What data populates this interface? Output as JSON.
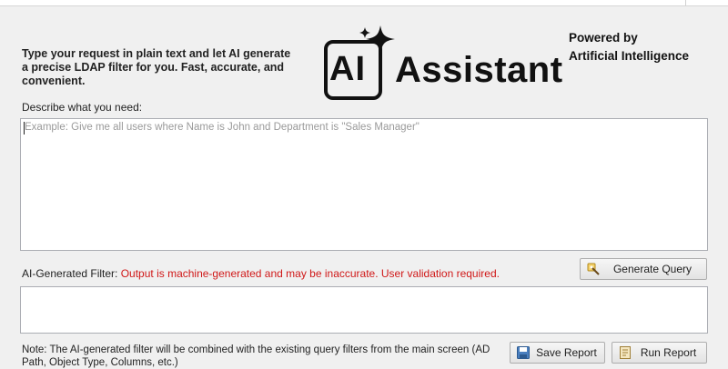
{
  "intro_text": "Type your request in plain text and let AI generate a precise LDAP filter for you. Fast, accurate, and convenient.",
  "logo": {
    "ai": "AI",
    "word": "Assistant"
  },
  "powered_by": {
    "line1": "Powered by",
    "line2": "Artificial Intelligence"
  },
  "request": {
    "label": "Describe what you need:",
    "value": "",
    "placeholder": "Example: Give me all users where Name is John and Department is \"Sales Manager\""
  },
  "filter": {
    "label": "AI-Generated Filter:",
    "warning": "Output is machine-generated and may be inaccurate. User validation required.",
    "value": ""
  },
  "buttons": {
    "generate": "Generate Query",
    "save": "Save Report",
    "run": "Run Report"
  },
  "note": "Note: The AI-generated filter will be combined with the existing query filters from the main screen (AD Path, Object Type, Columns, etc.)",
  "colors": {
    "warning": "#d01818",
    "border": "#abadb3"
  }
}
